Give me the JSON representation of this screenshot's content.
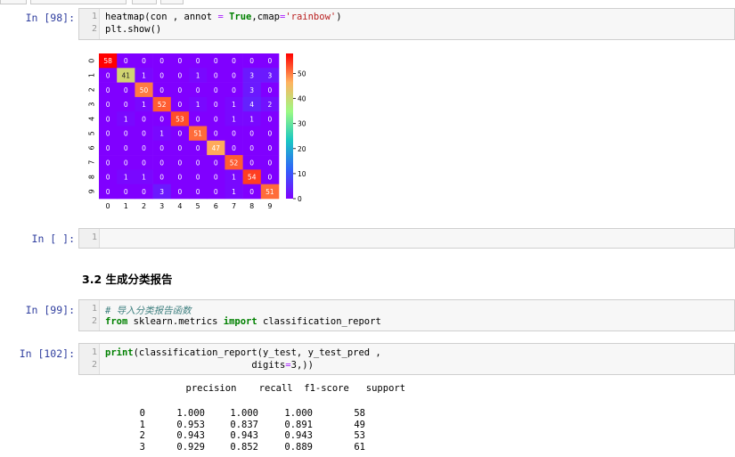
{
  "cells": {
    "c98": {
      "prompt": "In  [98]:",
      "ln1": "1",
      "ln2": "2"
    },
    "empty": {
      "prompt": "In  [ ]:",
      "ln1": "1"
    },
    "c99": {
      "prompt": "In  [99]:",
      "ln1": "1",
      "ln2": "2"
    },
    "c102": {
      "prompt": "In  [102]:",
      "ln1": "1",
      "ln2": "2"
    }
  },
  "code98": {
    "l1_fn": "heatmap(con , annot ",
    "l1_eq": "=",
    "l1_true": "True",
    "l1_mid": ",cmap",
    "l1_eq2": "=",
    "l1_str": "'rainbow'",
    "l1_end": ")",
    "l2": "plt.show()"
  },
  "heading": "3.2 生成分类报告",
  "code99": {
    "comment": "# 导入分类报告函数",
    "kw_from": "from",
    "module": " sklearn.metrics ",
    "kw_import": "import",
    "name": " classification_report"
  },
  "code102": {
    "l1_kw": "print",
    "l1_rest": "(classification_report(y_test, y_test_pred ,",
    "l2_pad": "                          digits",
    "l2_eq": "=",
    "l2_rest": "3,))"
  },
  "report": {
    "header": "              precision    recall  f1-score   support",
    "rows": [
      {
        "label": "0",
        "precision": "1.000",
        "recall": "1.000",
        "f1": "1.000",
        "support": "58"
      },
      {
        "label": "1",
        "precision": "0.953",
        "recall": "0.837",
        "f1": "0.891",
        "support": "49"
      },
      {
        "label": "2",
        "precision": "0.943",
        "recall": "0.943",
        "f1": "0.943",
        "support": "53"
      },
      {
        "label": "3",
        "precision": "0.929",
        "recall": "0.852",
        "f1": "0.889",
        "support": "61"
      }
    ]
  },
  "chart_data": {
    "type": "heatmap",
    "colormap": "rainbow",
    "x_labels": [
      "0",
      "1",
      "2",
      "3",
      "4",
      "5",
      "6",
      "7",
      "8",
      "9"
    ],
    "y_labels": [
      "0",
      "1",
      "2",
      "3",
      "4",
      "5",
      "6",
      "7",
      "8",
      "9"
    ],
    "matrix": [
      [
        58,
        0,
        0,
        0,
        0,
        0,
        0,
        0,
        0,
        0
      ],
      [
        0,
        41,
        1,
        0,
        0,
        1,
        0,
        0,
        3,
        3
      ],
      [
        0,
        0,
        50,
        0,
        0,
        0,
        0,
        0,
        3,
        0
      ],
      [
        0,
        0,
        1,
        52,
        0,
        1,
        0,
        1,
        4,
        2
      ],
      [
        0,
        1,
        0,
        0,
        53,
        0,
        0,
        1,
        1,
        0
      ],
      [
        0,
        0,
        0,
        1,
        0,
        51,
        0,
        0,
        0,
        0
      ],
      [
        0,
        0,
        0,
        0,
        0,
        0,
        47,
        0,
        0,
        0
      ],
      [
        0,
        0,
        0,
        0,
        0,
        0,
        0,
        52,
        0,
        0
      ],
      [
        0,
        1,
        1,
        0,
        0,
        0,
        0,
        1,
        54,
        0
      ],
      [
        0,
        0,
        0,
        3,
        0,
        0,
        0,
        1,
        0,
        51
      ]
    ],
    "vmin": 0,
    "vmax": 58,
    "colorbar_ticks": [
      "0",
      "10",
      "20",
      "30",
      "40",
      "50"
    ],
    "annot": true
  }
}
